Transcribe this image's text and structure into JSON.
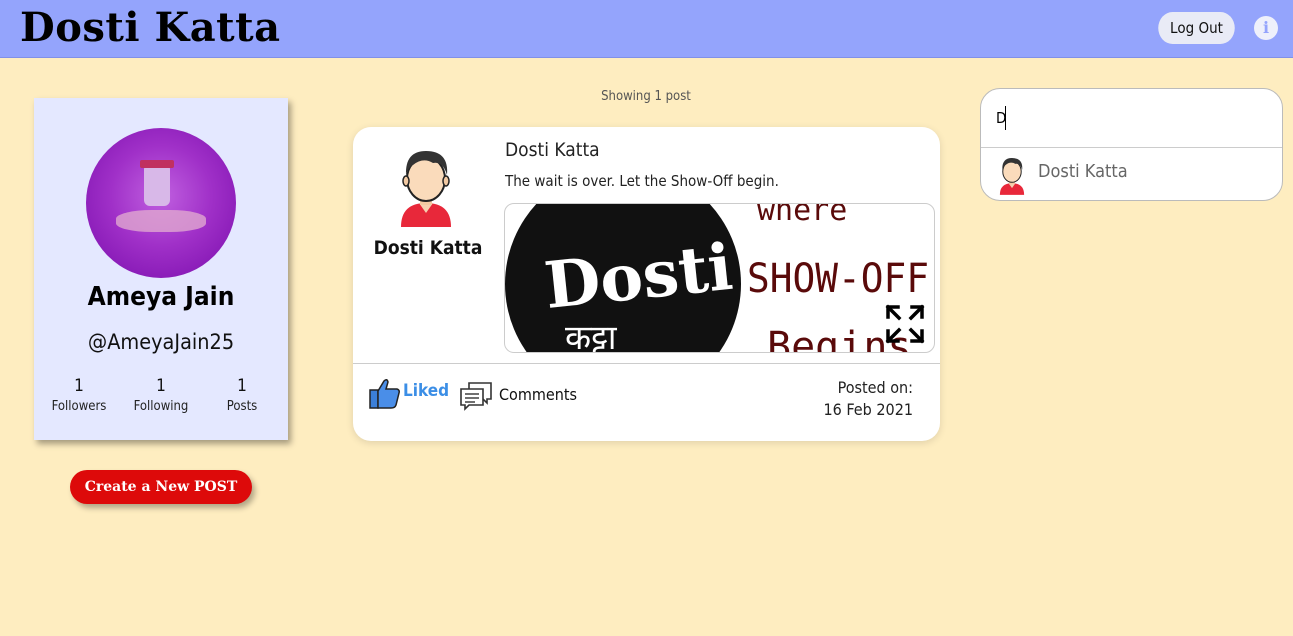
{
  "header": {
    "brand": "Dosti Katta",
    "logout_label": "Log Out",
    "info_icon": "info-icon"
  },
  "profile": {
    "name": "Ameya Jain",
    "handle": "@AmeyaJain25",
    "stats": [
      {
        "value": "1",
        "label": "Followers"
      },
      {
        "value": "1",
        "label": "Following"
      },
      {
        "value": "1",
        "label": "Posts"
      }
    ]
  },
  "create_button_label": "Create a New POST",
  "feed": {
    "showing_text": "Showing 1 post",
    "post": {
      "author": "Dosti Katta",
      "title": "Dosti Katta",
      "caption": "The wait is over. Let the Show-Off begin.",
      "image_text": {
        "logo_top": "Dosti",
        "logo_bottom": "कट्टा",
        "line1": "where",
        "line2": "SHOW-OFF",
        "line3": "Begins"
      },
      "like_label": "Liked",
      "comments_label": "Comments",
      "posted_label": "Posted on:",
      "posted_date": "16 Feb 2021"
    }
  },
  "search": {
    "value": "D",
    "results": [
      {
        "name": "Dosti Katta"
      }
    ]
  },
  "colors": {
    "header": "#94a4fc",
    "background": "#feedc0",
    "card": "#e4e8ff",
    "create_button": "#dd0a0a",
    "liked": "#3b8ee6"
  }
}
